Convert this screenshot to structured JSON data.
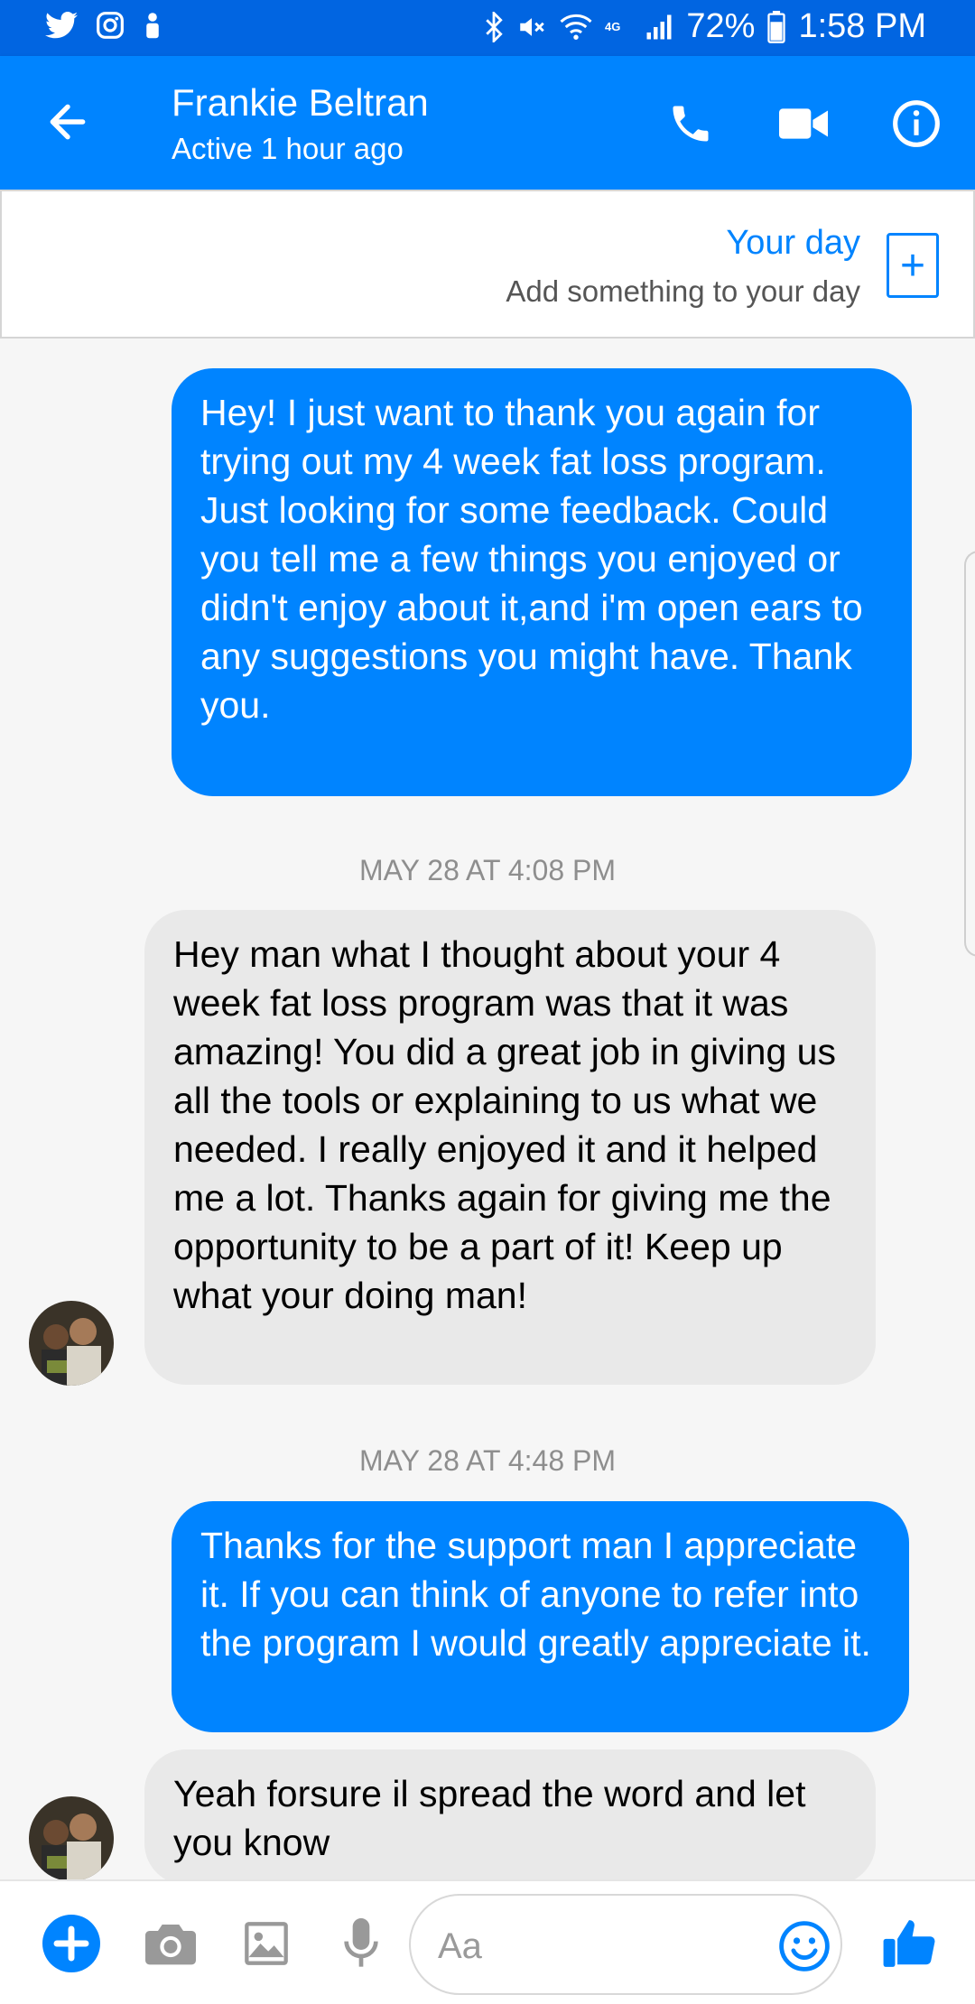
{
  "status_bar": {
    "battery": "72%",
    "time": "1:58 PM",
    "icons": [
      "twitter-icon",
      "instagram-icon",
      "person-icon",
      "bluetooth-icon",
      "mute-icon",
      "wifi-icon",
      "4g-icon",
      "signal-icon",
      "battery-icon"
    ]
  },
  "header": {
    "contact_name": "Frankie Beltran",
    "contact_status": "Active 1 hour ago"
  },
  "your_day": {
    "title": "Your day",
    "subtitle": "Add something to your day",
    "add_symbol": "+"
  },
  "messages": [
    {
      "type": "outgoing",
      "text": "Hey! I just want to thank you again for trying out my 4 week fat loss program. Just looking for some feedback. Could you tell me a few things you enjoyed or didn't enjoy about it,and i'm open ears to any suggestions you might have. Thank you."
    },
    {
      "type": "incoming",
      "text": "Hey man what I thought about your 4 week fat loss program was that it was amazing! You did a great job in giving us all the tools or explaining to us what we needed. I really enjoyed it and it helped me a lot. Thanks again for giving me the opportunity to be a part of it! Keep up what your doing man!"
    },
    {
      "type": "outgoing",
      "text": "Thanks for the support man I appreciate it. If you can think of anyone to refer into the program I would greatly appreciate it."
    },
    {
      "type": "incoming",
      "text": "Yeah forsure il spread the word and let you know"
    }
  ],
  "timestamps": [
    "MAY 28 AT 4:08 PM",
    "MAY 28 AT 4:48 PM"
  ],
  "composer": {
    "placeholder": "Aa"
  },
  "colors": {
    "status_bar": "#0165e1",
    "app_bar": "#0084ff",
    "outgoing_bubble": "#0084ff",
    "incoming_bubble": "#e9e9e9"
  }
}
